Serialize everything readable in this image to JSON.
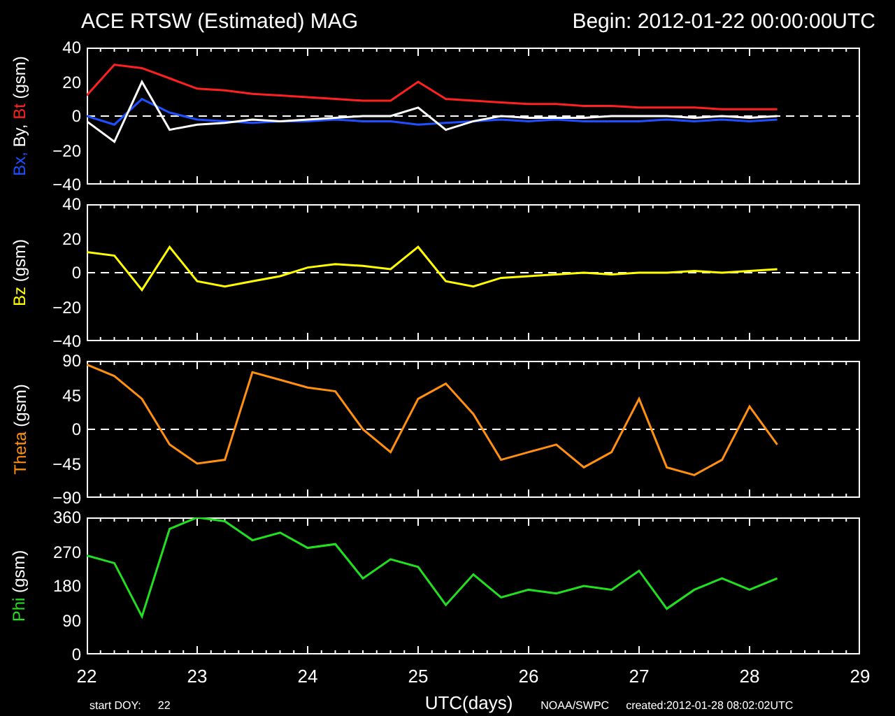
{
  "title": "ACE RTSW (Estimated) MAG",
  "begin": "Begin: 2012-01-22 00:00:00UTC",
  "panels": [
    {
      "name_separator": ",",
      "unit": "(gsm)",
      "chart_data": {
        "type": "line",
        "x": [
          22,
          22.25,
          22.5,
          22.75,
          23,
          23.25,
          23.5,
          23.75,
          24,
          24.25,
          24.5,
          24.75,
          25,
          25.25,
          25.5,
          25.75,
          26,
          26.25,
          26.5,
          26.75,
          27,
          27.25,
          27.5,
          27.75,
          28,
          28.25
        ],
        "xlim": [
          22,
          29
        ],
        "ylim": [
          -40,
          40
        ],
        "yticks": [
          {
            "value": 40,
            "label": "40"
          },
          {
            "value": 20,
            "label": "20"
          },
          {
            "value": 0,
            "label": "0"
          },
          {
            "value": -20,
            "label": "−20"
          },
          {
            "value": -40,
            "label": "−40"
          }
        ],
        "series": [
          {
            "name": "Bx",
            "color": "#1e50ff",
            "values": [
              0,
              -5,
              10,
              2,
              -2,
              -3,
              -4,
              -3,
              -3,
              -2,
              -3,
              -3,
              -5,
              -4,
              -3,
              -2,
              -3,
              -2,
              -3,
              -3,
              -3,
              -2,
              -3,
              -2,
              -3,
              -2
            ]
          },
          {
            "name": "By",
            "color": "#ffffff",
            "values": [
              -3,
              -15,
              20,
              -8,
              -5,
              -4,
              -2,
              -3,
              -2,
              -1,
              0,
              0,
              5,
              -8,
              -3,
              0,
              -1,
              -1,
              -1,
              0,
              0,
              0,
              -1,
              0,
              -1,
              0
            ]
          },
          {
            "name": "Bt",
            "color": "#ff2020",
            "values": [
              12,
              30,
              28,
              22,
              16,
              15,
              13,
              12,
              11,
              10,
              9,
              9,
              20,
              10,
              9,
              8,
              7,
              7,
              6,
              6,
              5,
              5,
              5,
              4,
              4,
              4
            ]
          }
        ]
      }
    },
    {
      "unit": "(gsm)",
      "chart_data": {
        "type": "line",
        "x": [
          22,
          22.25,
          22.5,
          22.75,
          23,
          23.25,
          23.5,
          23.75,
          24,
          24.25,
          24.5,
          24.75,
          25,
          25.25,
          25.5,
          25.75,
          26,
          26.25,
          26.5,
          26.75,
          27,
          27.25,
          27.5,
          27.75,
          28,
          28.25
        ],
        "xlim": [
          22,
          29
        ],
        "ylim": [
          -40,
          40
        ],
        "yticks": [
          {
            "value": 40,
            "label": "40"
          },
          {
            "value": 20,
            "label": "20"
          },
          {
            "value": 0,
            "label": "0"
          },
          {
            "value": -20,
            "label": "−20"
          },
          {
            "value": -40,
            "label": "−40"
          }
        ],
        "series": [
          {
            "name": "Bz",
            "color": "#ffff00",
            "values": [
              12,
              10,
              -10,
              15,
              -5,
              -8,
              -5,
              -2,
              3,
              5,
              4,
              2,
              15,
              -5,
              -8,
              -3,
              -2,
              -1,
              0,
              -1,
              0,
              0,
              1,
              0,
              1,
              2
            ]
          }
        ]
      }
    },
    {
      "unit": "(gsm)",
      "chart_data": {
        "type": "line",
        "x": [
          22,
          22.25,
          22.5,
          22.75,
          23,
          23.25,
          23.5,
          23.75,
          24,
          24.25,
          24.5,
          24.75,
          25,
          25.25,
          25.5,
          25.75,
          26,
          26.25,
          26.5,
          26.75,
          27,
          27.25,
          27.5,
          27.75,
          28,
          28.25
        ],
        "xlim": [
          22,
          29
        ],
        "ylim": [
          -90,
          90
        ],
        "yticks": [
          {
            "value": 90,
            "label": "90"
          },
          {
            "value": 45,
            "label": "45"
          },
          {
            "value": 0,
            "label": "0"
          },
          {
            "value": -45,
            "label": "−45"
          },
          {
            "value": -90,
            "label": "−90"
          }
        ],
        "series": [
          {
            "name": "Theta",
            "color": "#ff9010",
            "values": [
              85,
              70,
              40,
              -20,
              -45,
              -40,
              75,
              65,
              55,
              50,
              0,
              -30,
              40,
              60,
              20,
              -40,
              -30,
              -20,
              -50,
              -30,
              40,
              -50,
              -60,
              -40,
              30,
              -20
            ]
          }
        ]
      }
    },
    {
      "unit": "(gsm)",
      "chart_data": {
        "type": "line",
        "x": [
          22,
          22.25,
          22.5,
          22.75,
          23,
          23.25,
          23.5,
          23.75,
          24,
          24.25,
          24.5,
          24.75,
          25,
          25.25,
          25.5,
          25.75,
          26,
          26.25,
          26.5,
          26.75,
          27,
          27.25,
          27.5,
          27.75,
          28,
          28.25
        ],
        "xlim": [
          22,
          29
        ],
        "ylim": [
          0,
          360
        ],
        "yticks": [
          {
            "value": 360,
            "label": "360"
          },
          {
            "value": 270,
            "label": "270"
          },
          {
            "value": 180,
            "label": "180"
          },
          {
            "value": 90,
            "label": "90"
          },
          {
            "value": 0,
            "label": "0"
          }
        ],
        "xticks": [
          {
            "value": 22,
            "label": "22"
          },
          {
            "value": 23,
            "label": "23"
          },
          {
            "value": 24,
            "label": "24"
          },
          {
            "value": 25,
            "label": "25"
          },
          {
            "value": 26,
            "label": "26"
          },
          {
            "value": 27,
            "label": "27"
          },
          {
            "value": 28,
            "label": "28"
          },
          {
            "value": 29,
            "label": "29"
          }
        ],
        "series": [
          {
            "name": "Phi",
            "color": "#20e020",
            "values": [
              260,
              240,
              100,
              330,
              360,
              350,
              300,
              320,
              280,
              290,
              200,
              250,
              230,
              130,
              210,
              150,
              170,
              160,
              180,
              170,
              220,
              120,
              170,
              200,
              170,
              200
            ]
          }
        ]
      }
    }
  ],
  "footer": {
    "doy_label": "start DOY:",
    "doy": "22",
    "xlabel": "UTC(days)",
    "source": "NOAA/SWPC",
    "created": "created:2012-01-28 08:02:02UTC"
  }
}
